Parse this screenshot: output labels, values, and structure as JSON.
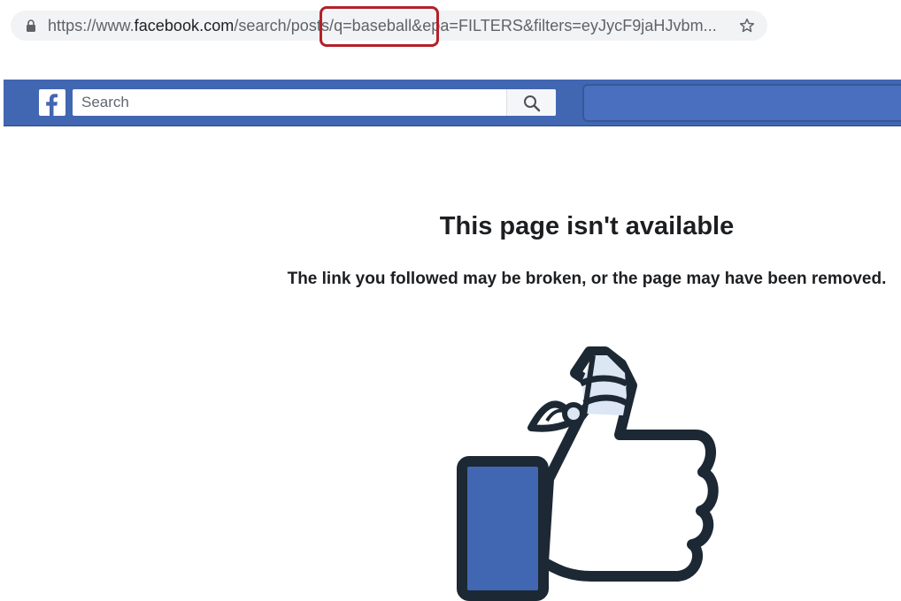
{
  "browser": {
    "url_prefix": "https://www.",
    "url_host": "facebook.com",
    "url_path": "/search/posts/q=baseball&epa=FILTERS&filters=eyJycF9jaHJvbm..."
  },
  "facebook": {
    "search_placeholder": "Search"
  },
  "error_page": {
    "title": "This page isn't available",
    "message": "The link you followed may be broken, or the page may have been removed."
  },
  "colors": {
    "facebook_blue": "#4267b2",
    "highlight_red": "#b3202a",
    "icon_outline": "#1c2833"
  },
  "icons": [
    "lock-icon",
    "star-icon",
    "facebook-logo",
    "search-icon",
    "broken-thumbs-up-icon"
  ]
}
